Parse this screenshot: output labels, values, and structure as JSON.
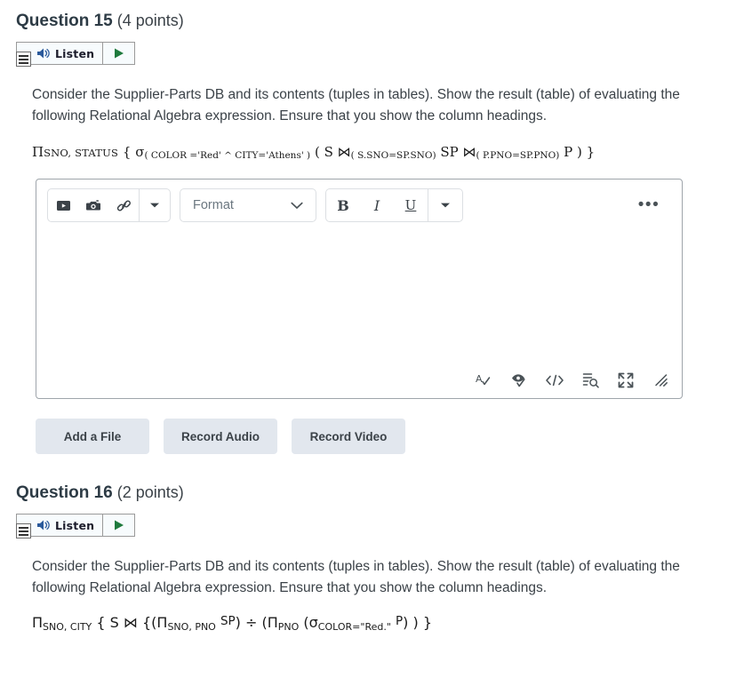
{
  "questions": [
    {
      "name": "Question 15",
      "points": "(4 points)",
      "listen": {
        "label": "Listen",
        "menu_icon": "hamburger-menu-icon",
        "speaker_icon": "speaker-icon",
        "play_icon": "play-triangle-icon"
      },
      "prompt": "Consider the Supplier-Parts DB and its contents (tuples in tables).   Show the result (table) of evaluating the following Relational Algebra expression.  Ensure that you show the column headings.",
      "expression": {
        "plain": "Π SNO, STATUS { σ( COLOR ='Red' ^ CITY='Athens' ) ( S ⋈(S.SNO=SP.SNO) SP ⋈(P.PNO=SP.PNO) P ) }",
        "parts": {
          "pi": "Π",
          "pi_sub": "SNO, STATUS",
          "open_brace": "{",
          "sigma": "σ",
          "sigma_cond": "( COLOR ='Red' ^ CITY='Athens' )",
          "open_paren": "(",
          "rel_s": "S",
          "join1": "⋈",
          "join1_cond": "( S.SNO=SP.SNO)",
          "rel_sp": "SP",
          "join2": "⋈",
          "join2_cond": "( P.PNO=SP.PNO)",
          "rel_p": "P",
          "close_paren": ")",
          "close_brace": "}"
        }
      },
      "editor": {
        "toolbar": {
          "media_icon": "video-icon",
          "image_icon": "camera-icon",
          "link_icon": "link-icon",
          "insert_more_icon": "chevron-down-icon",
          "format_label": "Format",
          "format_caret_icon": "chevron-down-icon",
          "bold_label": "B",
          "italic_label": "I",
          "underline_label": "U",
          "style_more_icon": "chevron-down-icon",
          "overflow_label": "•••"
        },
        "content": "",
        "status_icons": [
          "spellcheck-icon",
          "accessibility-checker-icon",
          "html-editor-icon",
          "word-count-icon",
          "fullscreen-icon",
          "resize-handle-icon"
        ]
      },
      "attachments": [
        {
          "label": "Add a File"
        },
        {
          "label": "Record Audio"
        },
        {
          "label": "Record Video"
        }
      ]
    },
    {
      "name": "Question 16",
      "points": "(2 points)",
      "listen": {
        "label": "Listen",
        "menu_icon": "hamburger-menu-icon",
        "speaker_icon": "speaker-icon",
        "play_icon": "play-triangle-icon"
      },
      "prompt": "Consider the Supplier-Parts DB and its contents (tuples in tables).   Show the result (table) of evaluating the following Relational Algebra expression.  Ensure that you show the column headings.",
      "expression": {
        "plain": "ΠSNO, CITY { S ⋈ { (ΠSNO, PNO SP) ÷ (ΠPNO ( σCOLOR=\"Red.\" P) ) }",
        "parts": {
          "pi": "Π",
          "pi_sub": "SNO, CITY",
          "open_brace": "{",
          "rel_s": "S",
          "join": "⋈",
          "open_brace2": "{",
          "open_paren1": "(",
          "pi2": "Π",
          "pi2_sub": "SNO, PNO",
          "rel_sp": "SP",
          "close_paren1": ")",
          "divide": "÷",
          "open_paren2": "(",
          "pi3": "Π",
          "pi3_sub": "PNO",
          "open_paren3": "(",
          "sigma": "σ",
          "sigma_sub": "COLOR=\"Red.\"",
          "rel_p": "P",
          "close_paren2": ")",
          "close_paren3": ")",
          "close_brace": "}"
        }
      }
    }
  ],
  "colors": {
    "text": "#3b4248",
    "heading": "#2d3b45",
    "speaker_blue": "#2b5a9b",
    "play_green": "#1f7a3d",
    "button_bg": "#e2e7ee",
    "editor_border": "#9fa5ab",
    "toolbar_border": "#dcdfe3",
    "format_label": "#6b7780"
  }
}
